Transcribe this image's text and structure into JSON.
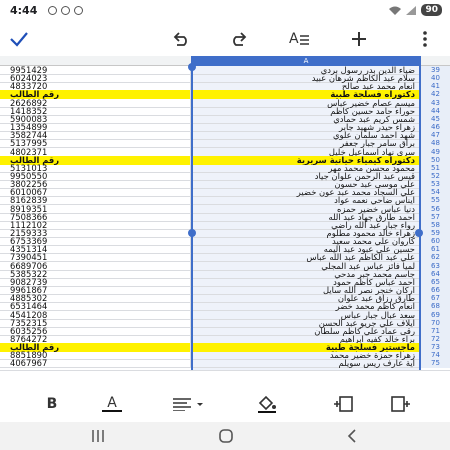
{
  "status_bar": {
    "time": "4:44",
    "battery": "90"
  },
  "toolbar": {
    "done": "done-check",
    "undo": "undo",
    "redo": "redo",
    "text_format": "text-format",
    "insert": "insert-plus",
    "more": "more-vertical"
  },
  "sheet": {
    "column_header": "A",
    "rows": [
      {
        "row": "39",
        "num": "9951429",
        "name": "ضياء الدين بدر رسول بردي",
        "highlight": false
      },
      {
        "row": "40",
        "num": "6024023",
        "name": "سلام عبد الكاظم شرهان عبيد",
        "highlight": false
      },
      {
        "row": "41",
        "num": "4833720",
        "name": "انعام محمد عبد صالح",
        "highlight": false
      },
      {
        "row": "42",
        "num": "رقم الطالب",
        "name": "دكتوراه فسلجة طبية",
        "highlight": true
      },
      {
        "row": "43",
        "num": "2626892",
        "name": "ميسم عصام خضير عباس",
        "highlight": false
      },
      {
        "row": "44",
        "num": "1418352",
        "name": "حوراء حامد حسين كاظم",
        "highlight": false
      },
      {
        "row": "45",
        "num": "5900083",
        "name": "شمس كريم عبد حمادي",
        "highlight": false
      },
      {
        "row": "46",
        "num": "1354899",
        "name": "زهراء حيدر شهيد جابر",
        "highlight": false
      },
      {
        "row": "47",
        "num": "3582744",
        "name": "شهد احمد سلمان علوي",
        "highlight": false
      },
      {
        "row": "48",
        "num": "5137995",
        "name": "براق سامر جبار جعفر",
        "highlight": false
      },
      {
        "row": "49",
        "num": "4802371",
        "name": "سرى نهاد اسماعيل خليل",
        "highlight": false
      },
      {
        "row": "50",
        "num": "رقم الطالب",
        "name": "دكتوراه كيمياء حياتية سريرية",
        "highlight": true
      },
      {
        "row": "51",
        "num": "5131013",
        "name": "محمود محسن محمد مهر",
        "highlight": false
      },
      {
        "row": "52",
        "num": "9950550",
        "name": "قيس عبد الرحمن علوان جياد",
        "highlight": false
      },
      {
        "row": "53",
        "num": "3802256",
        "name": "علي موسى عبد حسون",
        "highlight": false
      },
      {
        "row": "54",
        "num": "6010067",
        "name": "علي السجاد محمد عبد عون خضير",
        "highlight": false
      },
      {
        "row": "55",
        "num": "8162839",
        "name": "ايناس ضاحي نعمه عواد",
        "highlight": false
      },
      {
        "row": "56",
        "num": "8919351",
        "name": "دنيا عباس خضير حمزه",
        "highlight": false
      },
      {
        "row": "57",
        "num": "7508366",
        "name": "احمد طارق جهاد عبد الله",
        "highlight": false
      },
      {
        "row": "58",
        "num": "1112102",
        "name": "رواء جبار عبد الله راضي",
        "highlight": false
      },
      {
        "row": "59",
        "num": "2159333",
        "name": "زهراء خالد محمود مطلوم",
        "highlight": false
      },
      {
        "row": "60",
        "num": "6753369",
        "name": "كاروان علي محمد سعيد",
        "highlight": false
      },
      {
        "row": "61",
        "num": "4351314",
        "name": "حسين علي عبود عبد اليمه",
        "highlight": false
      },
      {
        "row": "62",
        "num": "7390451",
        "name": "علي عبد الكاظم عبد الله عباس",
        "highlight": false
      },
      {
        "row": "63",
        "num": "6689706",
        "name": "لميا فائز عباس عبد المجلي",
        "highlight": false
      },
      {
        "row": "64",
        "num": "5385322",
        "name": "جاسم محمد جبر مدحي",
        "highlight": false
      },
      {
        "row": "65",
        "num": "9082739",
        "name": "احمد عباس كاظم حمود",
        "highlight": false
      },
      {
        "row": "66",
        "num": "9961867",
        "name": "اركان خنجر نصر الله سايل",
        "highlight": false
      },
      {
        "row": "67",
        "num": "4885302",
        "name": "طارق رزاق عبد علوان",
        "highlight": false
      },
      {
        "row": "68",
        "num": "6531464",
        "name": "انعام كاظم محمد خضر",
        "highlight": false
      },
      {
        "row": "69",
        "num": "4541208",
        "name": "سعد عبال جبار عباس",
        "highlight": false
      },
      {
        "row": "70",
        "num": "7352315",
        "name": "ايلاف علي جريو عبد الحسن",
        "highlight": false
      },
      {
        "row": "71",
        "num": "6035256",
        "name": "رقى عماد علي كاظم سلطان",
        "highlight": false
      },
      {
        "row": "72",
        "num": "8764272",
        "name": "براء خالد كفيه ابراهيم",
        "highlight": false
      },
      {
        "row": "73",
        "num": "رقم الطالب",
        "name": "ماجستير فسلجة طبية",
        "highlight": true
      },
      {
        "row": "74",
        "num": "8851890",
        "name": "زهراء حمزة خضير محمد",
        "highlight": false
      },
      {
        "row": "75",
        "num": "4067967",
        "name": "اية عارف ريس سويلم",
        "highlight": false
      }
    ]
  },
  "format_bar": {
    "bold": "B",
    "text_color": "A",
    "align": "align-left",
    "fill": "fill-color",
    "insert_row": "insert-row",
    "insert_column": "insert-column"
  },
  "nav_bar": {
    "recent": "recent-apps",
    "home": "home",
    "back": "back"
  }
}
